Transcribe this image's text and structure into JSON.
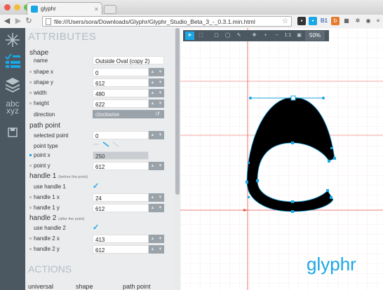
{
  "browser": {
    "tab_title": "glyphr",
    "tab_icon": "glyphr-favicon-icon",
    "url": "file:///Users/sora/Downloads/Glyphr/Glyphr_Studio_Beta_3_-_0.3.1.min.html",
    "ext_b1": "B1",
    "ext_bitly": "b"
  },
  "attributes": {
    "title": "ATTRIBUTES",
    "shape_header": "shape",
    "name_label": "name",
    "name_value": "Outside Oval (copy 2)",
    "shape_x_label": "shape x",
    "shape_x": "0",
    "shape_y_label": "shape y",
    "shape_y": "612",
    "width_label": "width",
    "width": "480",
    "height_label": "height",
    "height": "622",
    "direction_label": "direction",
    "direction": "clockwise",
    "path_point_header": "path point",
    "selected_point_label": "selected point",
    "selected_point": "0",
    "point_type_label": "point type",
    "point_x_label": "point x",
    "point_x": "250",
    "point_y_label": "point y",
    "point_y": "612",
    "handle1_header": "handle 1",
    "handle1_sub": "(before the point)",
    "use_handle1_label": "use handle 1",
    "handle1_x_label": "handle 1 x",
    "handle1_x": "24",
    "handle1_y_label": "handle 1 y",
    "handle1_y": "612",
    "handle2_header": "handle 2",
    "handle2_sub": "(after the point)",
    "use_handle2_label": "use handle 2",
    "handle2_x_label": "handle 2 x",
    "handle2_x": "413",
    "handle2_y_label": "handle 2 y",
    "handle2_y": "612"
  },
  "actions": {
    "title": "ACTIONS",
    "col_universal": "universal",
    "col_shape": "shape",
    "col_path_point": "path point"
  },
  "canvas": {
    "zoom": "50%",
    "logo_text": "glyphr",
    "accent": "#1aa7e5",
    "guide_color": "#e8524a"
  }
}
